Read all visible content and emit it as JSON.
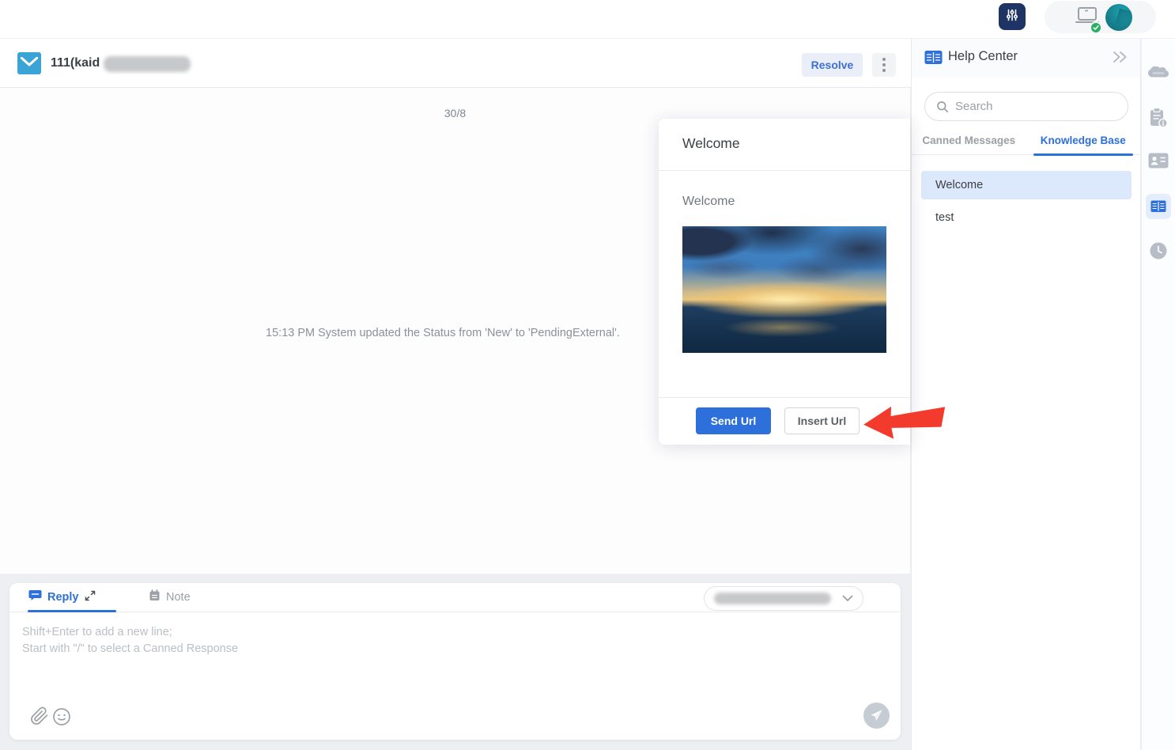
{
  "colors": {
    "accent_blue": "#2d6fdb",
    "navy_button": "#1e3465",
    "arrow_red": "#f23a2d",
    "avatar_teal": "#17818f",
    "online_green": "#27ae60",
    "selected_item_bg": "#dce8fb",
    "resolve_bg": "#e9eef9"
  },
  "ticket": {
    "title": "111(kaid",
    "resolve_label": "Resolve"
  },
  "chat": {
    "date_divider": "30/8",
    "system_message": "15:13 PM System updated the Status from 'New' to 'PendingExternal'."
  },
  "article_modal": {
    "title": "Welcome",
    "article_heading": "Welcome",
    "send_url_label": "Send Url",
    "insert_url_label": "Insert Url"
  },
  "help_center": {
    "title": "Help Center",
    "search_placeholder": "Search",
    "tabs": [
      {
        "label": "Canned Messages",
        "active": false
      },
      {
        "label": "Knowledge Base",
        "active": true
      }
    ],
    "articles": [
      {
        "label": "Welcome",
        "selected": true
      },
      {
        "label": "test",
        "selected": false
      }
    ]
  },
  "composer": {
    "reply_tab_label": "Reply",
    "note_tab_label": "Note",
    "placeholder_line1": "Shift+Enter to add a new line;",
    "placeholder_line2": "Start with \"/\" to select a Canned Response"
  },
  "icons": {
    "settings": "sliders-icon",
    "device_status": "laptop-with-green-check-icon",
    "ticket_channel": "email-envelope-icon",
    "header_menu": "kebab-menu-icon",
    "help_center": "open-book-icon",
    "collapse_panel": "double-chevron-right-icon",
    "search": "magnifier-icon",
    "strip": [
      "salesforce-cloud-icon",
      "clipboard-info-icon",
      "contact-card-icon",
      "knowledge-book-icon",
      "history-clock-icon"
    ],
    "composer": [
      "chat-bubble-icon",
      "expand-icon",
      "note-pad-icon",
      "chevron-down-icon",
      "paperclip-icon",
      "emoji-smile-icon",
      "send-plane-icon"
    ],
    "annotation": "red-arrow-pointing-left"
  }
}
